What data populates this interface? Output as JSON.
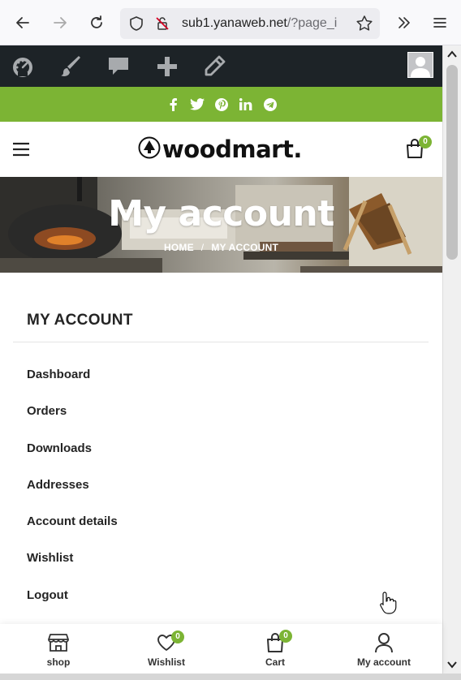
{
  "browser": {
    "url_domain": "sub1.yanaweb.net",
    "url_rest": "/?page_i",
    "icons": [
      "back-arrow-icon",
      "forward-arrow-icon",
      "reload-icon",
      "shield-icon",
      "lock-off-icon",
      "star-icon",
      "overflow-chevron-icon",
      "hamburger-menu-icon"
    ]
  },
  "adminbar": {
    "icons": [
      "dashboard-icon",
      "brush-icon",
      "comment-icon",
      "plus-icon",
      "pencil-icon",
      "avatar"
    ]
  },
  "social": {
    "icons": [
      "facebook-icon",
      "twitter-icon",
      "pinterest-icon",
      "linkedin-icon",
      "telegram-icon"
    ]
  },
  "header": {
    "logo_text": "woodmart.",
    "cart_count": "0"
  },
  "hero": {
    "title": "My account",
    "breadcrumb_home": "HOME",
    "breadcrumb_sep": "/",
    "breadcrumb_current": "MY ACCOUNT"
  },
  "account": {
    "title": "MY ACCOUNT",
    "menu": [
      "Dashboard",
      "Orders",
      "Downloads",
      "Addresses",
      "Account details",
      "Wishlist",
      "Logout"
    ]
  },
  "toolbar": {
    "shop": "shop",
    "wishlist": "Wishlist",
    "wishlist_count": "0",
    "cart": "Cart",
    "cart_count": "0",
    "account": "My account"
  },
  "colors": {
    "accent": "#7cb434",
    "adminbar": "#1d2327"
  }
}
